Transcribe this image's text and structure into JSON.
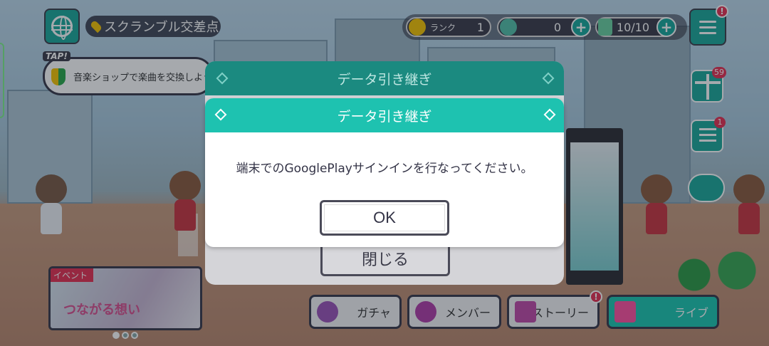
{
  "location": {
    "name": "スクランブル交差点"
  },
  "hud": {
    "rank_label": "ランク",
    "rank_value": "1",
    "gems": "0",
    "stamina": "10/10",
    "menu_badge": "!"
  },
  "side": {
    "gift_count": "59",
    "mission_count": "1"
  },
  "tap": {
    "label": "TAP!",
    "hint": "音楽ショップで楽曲を交換しよう"
  },
  "event": {
    "tag": "イベント",
    "title": "つながる想い"
  },
  "nav": {
    "gacha": "ガチャ",
    "member": "メンバー",
    "story": "ストーリー",
    "story_badge": "!",
    "live": "ライブ"
  },
  "back_dialog": {
    "title": "データ引き継ぎ",
    "close_label": "閉じる"
  },
  "dialog": {
    "title": "データ引き継ぎ",
    "message": "端末でのGooglePlayサインインを行なってください。",
    "ok_label": "OK"
  },
  "colors": {
    "header_teal": "#1ec2b0",
    "back_header_teal": "#1b8a80",
    "badge_red": "#e53052"
  }
}
